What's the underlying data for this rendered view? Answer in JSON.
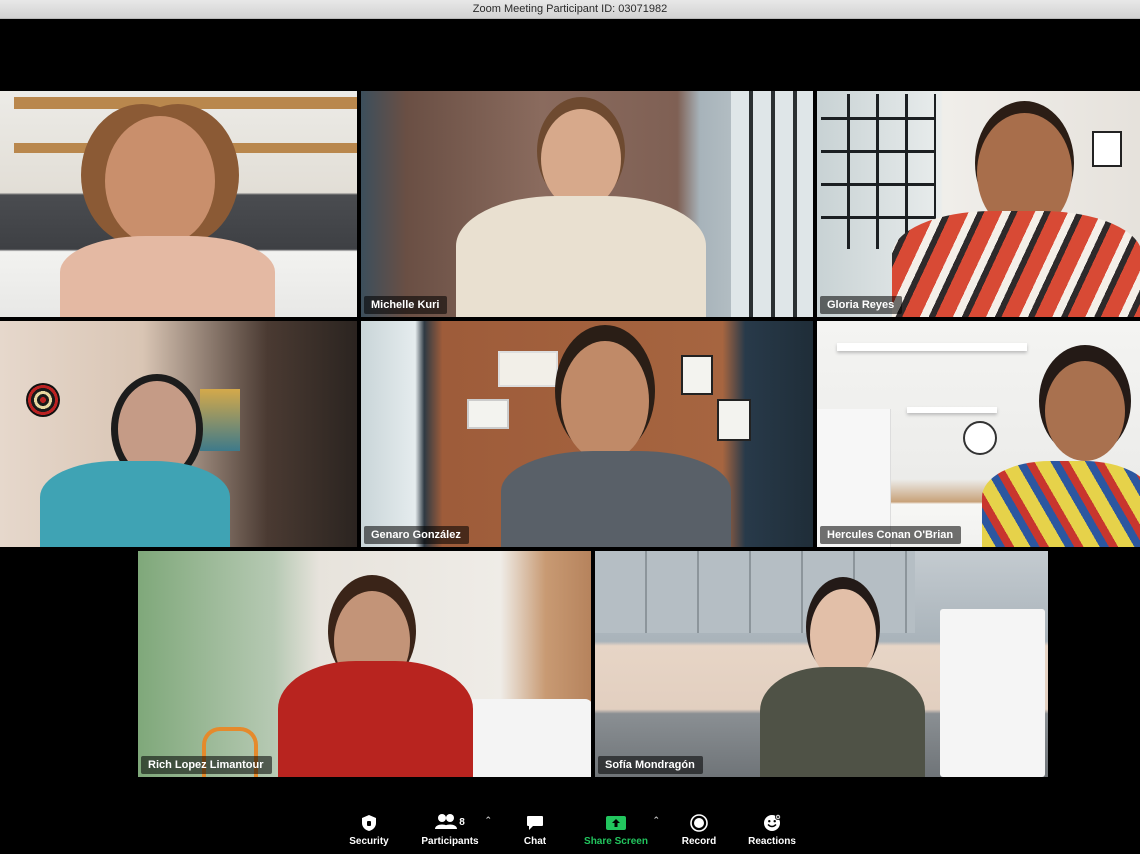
{
  "window": {
    "title": "Zoom Meeting Participant ID: 03071982"
  },
  "participants": [
    {
      "name": "",
      "tile": "tile-1"
    },
    {
      "name": "Michelle Kuri",
      "tile": "tile-2"
    },
    {
      "name": "Gloria Reyes",
      "tile": "tile-3",
      "active_speaker": true
    },
    {
      "name": "",
      "tile": "tile-4"
    },
    {
      "name": "Genaro González",
      "tile": "tile-5"
    },
    {
      "name": "Hercules Conan O'Brian",
      "tile": "tile-6"
    },
    {
      "name": "Rich Lopez Limantour",
      "tile": "tile-7"
    },
    {
      "name": "Sofía Mondragón",
      "tile": "tile-8"
    }
  ],
  "toolbar": {
    "security_label": "Security",
    "participants_label": "Participants",
    "participants_count": "8",
    "chat_label": "Chat",
    "share_label": "Share Screen",
    "record_label": "Record",
    "reactions_label": "Reactions"
  },
  "colors": {
    "active_speaker": "#22c55e",
    "share": "#22c55e",
    "toolbar_bg": "#000000"
  },
  "icons": [
    "shield-icon",
    "people-icon",
    "chat-bubble-icon",
    "share-screen-icon",
    "record-icon",
    "smile-icon",
    "caret-up-icon"
  ]
}
